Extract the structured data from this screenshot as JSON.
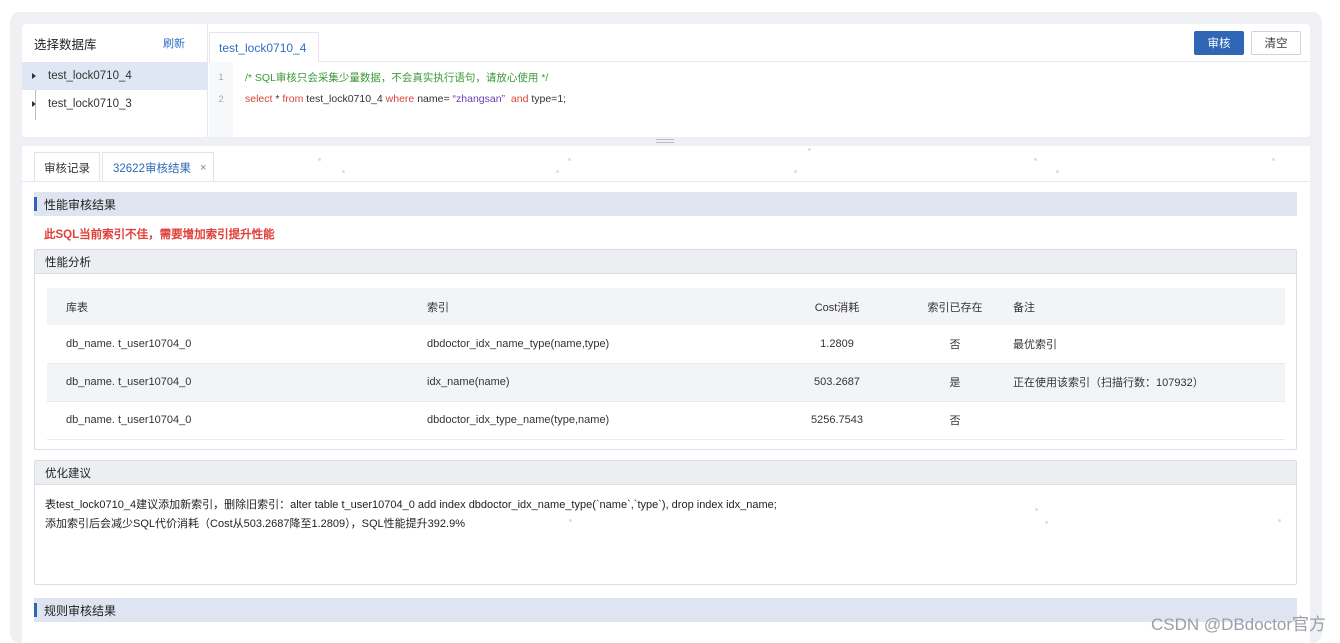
{
  "database_panel": {
    "title": "选择数据库",
    "refresh_label": "刷新",
    "items": [
      {
        "label": "test_lock0710_4"
      },
      {
        "label": "test_lock0710_3"
      }
    ]
  },
  "editor": {
    "tab_label": "test_lock0710_4",
    "audit_button": "审核",
    "clear_button": "清空",
    "lines": [
      {
        "num": "1",
        "comment": "/* SQL审核只会采集少量数据，不会真实执行语句，请放心使用 */"
      },
      {
        "num": "2",
        "kw1": "select",
        "t1": " * ",
        "kw2": "from",
        "t2": " test_lock0710_4 ",
        "kw3": "where",
        "t3": " name= ",
        "str": "“zhangsan”",
        "t4": "  ",
        "kw4": "and",
        "t5": " type=1;"
      }
    ]
  },
  "result_tabs": {
    "history_label": "审核记录",
    "result_label": "32622审核结果",
    "close_icon": "×"
  },
  "performance": {
    "section_title": "性能审核结果",
    "warning": "此SQL当前索引不佳，需要增加索引提升性能",
    "analysis_title": "性能分析",
    "columns": [
      "库表",
      "索引",
      "Cost消耗",
      "索引已存在",
      "备注"
    ],
    "rows": [
      {
        "table": "db_name. t_user10704_0",
        "index": "dbdoctor_idx_name_type(name,type)",
        "cost": "1.2809",
        "exists": "否",
        "note": "最优索引"
      },
      {
        "table": "db_name. t_user10704_0",
        "index": "idx_name(name)",
        "cost": "503.2687",
        "exists": "是",
        "note": "正在使用该索引（扫描行数：107932）"
      },
      {
        "table": "db_name. t_user10704_0",
        "index": "dbdoctor_idx_type_name(type,name)",
        "cost": "5256.7543",
        "exists": "否",
        "note": ""
      }
    ]
  },
  "optimization": {
    "title": "优化建议",
    "lines": [
      "表test_lock0710_4建议添加新索引，删除旧索引：alter table t_user10704_0 add index dbdoctor_idx_name_type(`name`,`type`), drop index idx_name;",
      "添加索引后会减少SQL代价消耗（Cost从503.2687降至1.2809），SQL性能提升392.9%"
    ]
  },
  "rules": {
    "section_title": "规则审核结果"
  },
  "watermark": "CSDN @DBdoctor官方"
}
